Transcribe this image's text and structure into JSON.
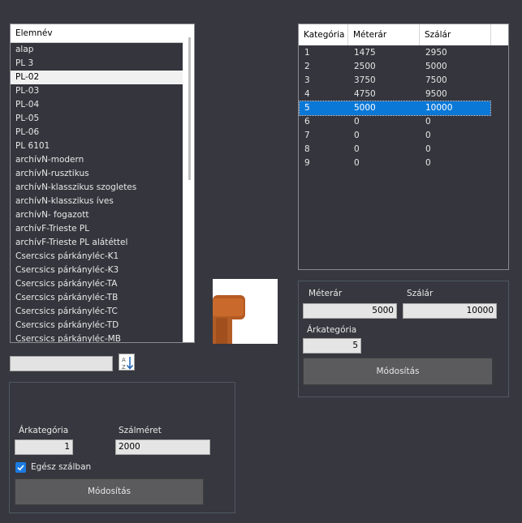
{
  "element_list": {
    "header": "Elemnév",
    "selected_index": 2,
    "items": [
      "alap",
      "PL 3",
      "PL-02",
      "PL-03",
      "PL-04",
      "PL-05",
      "PL-06",
      "PL 6101",
      "archívN-modern",
      "archívN-rusztikus",
      "archívN-klasszikus szogletes",
      "archívN-klasszikus íves",
      "archívN- fogazott",
      "archívF-Trieste PL",
      "archívF-Trieste PL alátéttel",
      "Csercsics párkányléc-K1",
      "Csercsics párkányléc-K3",
      "Csercsics párkányléc-TA",
      "Csercsics párkányléc-TB",
      "Csercsics párkányléc-TC",
      "Csercsics párkányléc-TD",
      "Csercsics párkányléc-MB"
    ]
  },
  "search": {
    "value": ""
  },
  "sort_button": {
    "icon": "sort-az-icon"
  },
  "left_panel": {
    "arkategoria_label": "Árkategória",
    "arkategoria_value": "1",
    "szalmeret_label": "Szálméret",
    "szalmeret_value": "2000",
    "whole_label": "Egész szálban",
    "whole_checked": true,
    "modify_label": "Módosítás"
  },
  "price_grid": {
    "headers": [
      "Kategória",
      "Méterár",
      "Szálár"
    ],
    "selected_row": 4,
    "rows": [
      [
        "1",
        "1475",
        "2950"
      ],
      [
        "2",
        "2500",
        "5000"
      ],
      [
        "3",
        "3750",
        "7500"
      ],
      [
        "4",
        "4750",
        "9500"
      ],
      [
        "5",
        "5000",
        "10000"
      ],
      [
        "6",
        "0",
        "0"
      ],
      [
        "7",
        "0",
        "0"
      ],
      [
        "8",
        "0",
        "0"
      ],
      [
        "9",
        "0",
        "0"
      ]
    ]
  },
  "right_panel": {
    "meterar_label": "Méterár",
    "meterar_value": "5000",
    "szalar_label": "Szálár",
    "szalar_value": "10000",
    "arkategoria_label": "Árkategória",
    "arkategoria_value": "5",
    "modify_label": "Módosítás"
  },
  "colors": {
    "selection": "#0a78d7",
    "background": "#37373f",
    "checkbox": "#1b7be0"
  }
}
